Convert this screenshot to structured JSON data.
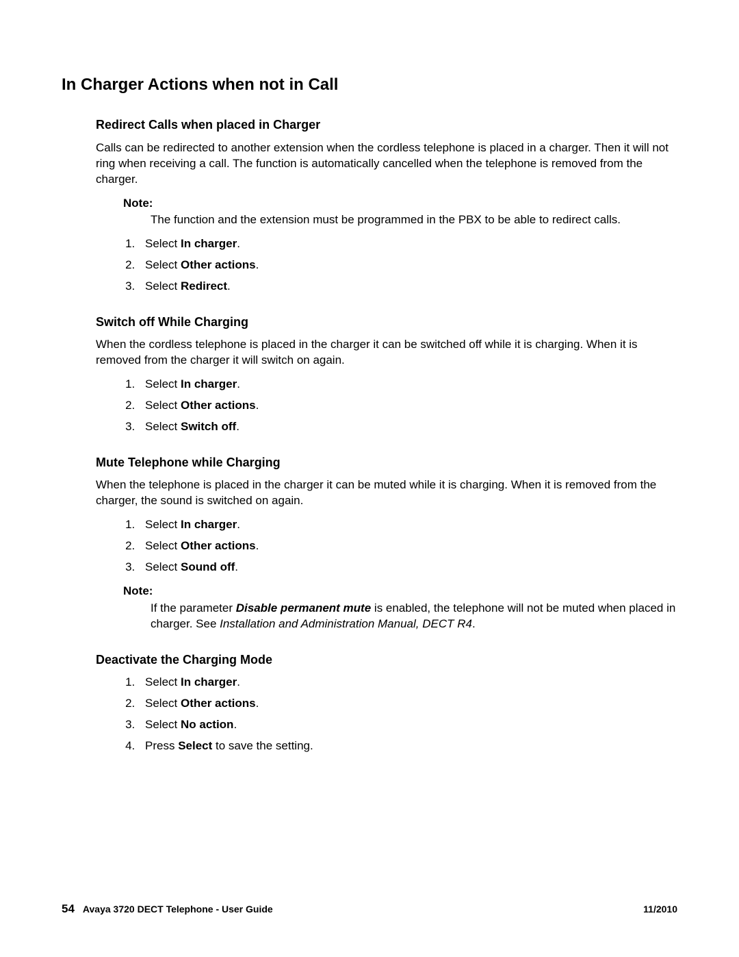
{
  "main_heading": "In Charger Actions when not in Call",
  "redirect": {
    "heading": "Redirect Calls when placed in Charger",
    "intro": "Calls can be redirected to another extension when the cordless telephone is placed in a charger. Then it will not ring when receiving a call. The function is automatically cancelled when the telephone is removed from the charger.",
    "note_label": "Note:",
    "note_text": "The function and the extension must be programmed in the PBX to be able to redirect calls.",
    "step1_prefix": "Select ",
    "step1_bold": "In charger",
    "step1_suffix": ".",
    "step2_prefix": "Select ",
    "step2_bold": "Other actions",
    "step2_suffix": ".",
    "step3_prefix": "Select ",
    "step3_bold": "Redirect",
    "step3_suffix": "."
  },
  "switchoff": {
    "heading": "Switch off While Charging",
    "intro": "When the cordless telephone is placed in the charger it can be switched off while it is charging. When it is removed from the charger it will switch on again.",
    "step1_prefix": "Select ",
    "step1_bold": "In charger",
    "step1_suffix": ".",
    "step2_prefix": "Select ",
    "step2_bold": "Other actions",
    "step2_suffix": ".",
    "step3_prefix": "Select ",
    "step3_bold": "Switch off",
    "step3_suffix": "."
  },
  "mute": {
    "heading": "Mute Telephone while Charging",
    "intro": "When the telephone is placed in the charger it can be muted while it is charging. When it is removed from the charger, the sound is switched on again.",
    "step1_prefix": "Select ",
    "step1_bold": "In charger",
    "step1_suffix": ".",
    "step2_prefix": "Select ",
    "step2_bold": "Other actions",
    "step2_suffix": ".",
    "step3_prefix": "Select ",
    "step3_bold": "Sound off",
    "step3_suffix": ".",
    "note_label": "Note:",
    "note_p1": "If the parameter ",
    "note_bold_italic": "Disable permanent mute",
    "note_p2": " is enabled, the telephone will not be muted when placed in charger. See ",
    "note_italic": "Installation and Administration Manual, DECT R4",
    "note_p3": "."
  },
  "deactivate": {
    "heading": "Deactivate the Charging Mode",
    "step1_prefix": "Select ",
    "step1_bold": "In charger",
    "step1_suffix": ".",
    "step2_prefix": "Select ",
    "step2_bold": "Other actions",
    "step2_suffix": ".",
    "step3_prefix": "Select ",
    "step3_bold": "No action",
    "step3_suffix": ".",
    "step4_prefix": "Press ",
    "step4_bold": "Select",
    "step4_suffix": " to save the setting."
  },
  "footer": {
    "page_number": "54",
    "doc_title": "Avaya 3720 DECT Telephone - User Guide",
    "date": "11/2010"
  }
}
